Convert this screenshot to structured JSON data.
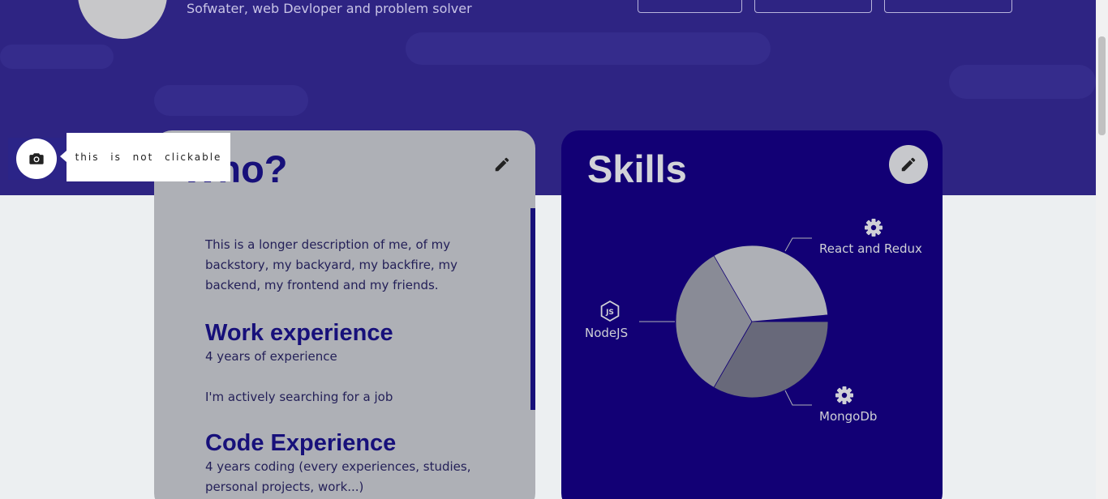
{
  "header": {
    "subtitle": "Sofwater, web Devloper and problem solver"
  },
  "profile_photo": {
    "icon": "camera-icon",
    "tooltip": "this is not clickable"
  },
  "who_card": {
    "title": "Who?",
    "title_visible": "ho?",
    "description": "This is a longer description of me, of my backstory, my backyard, my backfire, my backend, my frontend and my friends.",
    "work_title": "Work experience",
    "work_years": "4 years of experience",
    "work_status": "I'm actively searching for a job",
    "code_title": "Code Experience",
    "code_years": "4 years coding (every experiences, studies, personal projects, work...)"
  },
  "skills_card": {
    "title": "Skills"
  },
  "chart_data": {
    "type": "pie",
    "slices": [
      {
        "label": "React and Redux",
        "value": 1,
        "icon": "gear-icon",
        "color": "#aeb0b6"
      },
      {
        "label": "MongoDb",
        "value": 1,
        "icon": "gear-icon",
        "color": "#68697a"
      },
      {
        "label": "NodeJS",
        "value": 1,
        "icon": "nodejs-icon",
        "color": "#898b96"
      }
    ]
  },
  "colors": {
    "hero": "#2e2483",
    "accent": "#17107a",
    "skills_bg": "#120075"
  }
}
